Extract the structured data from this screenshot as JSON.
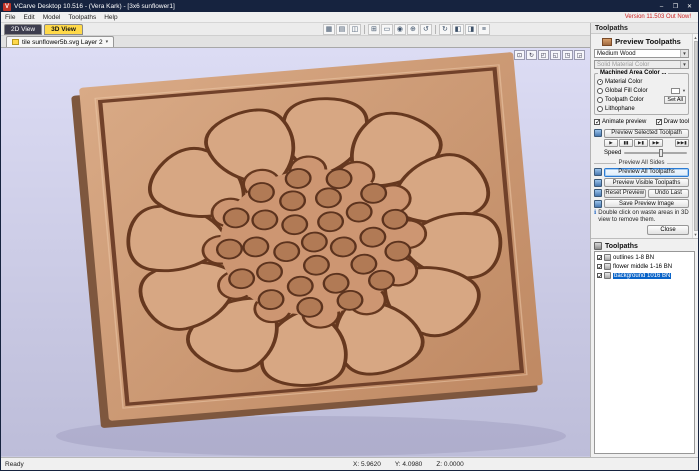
{
  "titlebar": {
    "app_icon": "V",
    "title": "VCarve Desktop 10.516 - (Vera Kark) - [3x6 sunflower1]",
    "minimize": "–",
    "maximize": "❐",
    "close": "✕"
  },
  "menubar": {
    "items": [
      "File",
      "Edit",
      "Model",
      "Toolpaths",
      "Help"
    ],
    "version_banner": "Version 11.503 Out Now!"
  },
  "view_tabs": {
    "tab_2d": "2D View",
    "tab_3d": "3D View"
  },
  "toolbar": {
    "icons": [
      {
        "name": "grid-icon",
        "glyph": "▦"
      },
      {
        "name": "snap-grid-icon",
        "glyph": "▤"
      },
      {
        "name": "guides-icon",
        "glyph": "◫"
      },
      {
        "name": "snap-objects-icon",
        "glyph": "⊞"
      },
      {
        "name": "ruler-icon",
        "glyph": "▭"
      },
      {
        "name": "origin-icon",
        "glyph": "◉"
      },
      {
        "name": "magnet-icon",
        "glyph": "⊕"
      },
      {
        "name": "rotate-ccw-icon",
        "glyph": "↺"
      },
      {
        "name": "rotate-cw-icon",
        "glyph": "↻"
      },
      {
        "name": "shade-left-icon",
        "glyph": "◧"
      },
      {
        "name": "shade-right-icon",
        "glyph": "◨"
      },
      {
        "name": "layers-icon",
        "glyph": "≡"
      }
    ]
  },
  "doc_tab": {
    "label": "tile sunflower5b.svg Layer 2",
    "caret": "▾"
  },
  "canvas": {
    "view_icons": [
      {
        "name": "zoom-fit-icon",
        "glyph": "⊡"
      },
      {
        "name": "rotate-view-icon",
        "glyph": "↻"
      },
      {
        "name": "top-view-icon",
        "glyph": "◰"
      },
      {
        "name": "front-view-icon",
        "glyph": "◱"
      },
      {
        "name": "side-view-icon",
        "glyph": "◳"
      },
      {
        "name": "iso-view-icon",
        "glyph": "◲"
      }
    ]
  },
  "preview_panel": {
    "header": "Toolpaths",
    "title": "Preview Toolpaths",
    "material_select": "Medium Wood",
    "solid_color_select": "Solid Material Color",
    "machined_group_label": "Machined Area Color ...",
    "radio_material": "Material Color",
    "radio_global_fill": "Global Fill Color",
    "radio_toolpath": "Toolpath Color",
    "radio_lithophane": "Lithophane",
    "set_all_button": "Set All",
    "animate_checkbox": "Animate preview",
    "draw_tool_checkbox": "Draw tool",
    "preview_selected_button": "Preview Selected Toolpath",
    "playback": {
      "play": "▶",
      "pause": "▮▮",
      "step": "▶▮",
      "fast": "▶▶",
      "end": "▶▶▮"
    },
    "speed_label": "Speed",
    "all_sides_divider": "Preview All Sides",
    "preview_all_button": "Preview All Toolpaths",
    "preview_visible_button": "Preview Visible Toolpaths",
    "reset_button": "Reset Preview",
    "undo_button": "Undo Last",
    "save_image_button": "Save Preview Image",
    "hint_icon": "ℹ",
    "hint_text": "Double click on waste areas in 3D view to remove them.",
    "close_button": "Close",
    "scroll_up": "▲",
    "scroll_down": "▼"
  },
  "toolpaths_list": {
    "header": "Toolpaths",
    "items": [
      {
        "label": "outlines 1-8 BN",
        "checked": true,
        "selected": false
      },
      {
        "label": "flower middle 1-16 BN",
        "checked": true,
        "selected": false
      },
      {
        "label": "background 1016 BN",
        "checked": true,
        "selected": true
      }
    ]
  },
  "statusbar": {
    "ready": "Ready",
    "x": "X: 5.9620",
    "y": "Y: 4.0980",
    "z": "Z: 0.0000"
  },
  "colors": {
    "titlebar_navy": "#16233f",
    "tab_active_yellow": "#ffd949",
    "version_red": "#cc2222",
    "selection_blue": "#0a64c8",
    "wood": "#c99271",
    "canvas_top": "#dcdcf4",
    "canvas_bottom": "#bdbdd9"
  }
}
